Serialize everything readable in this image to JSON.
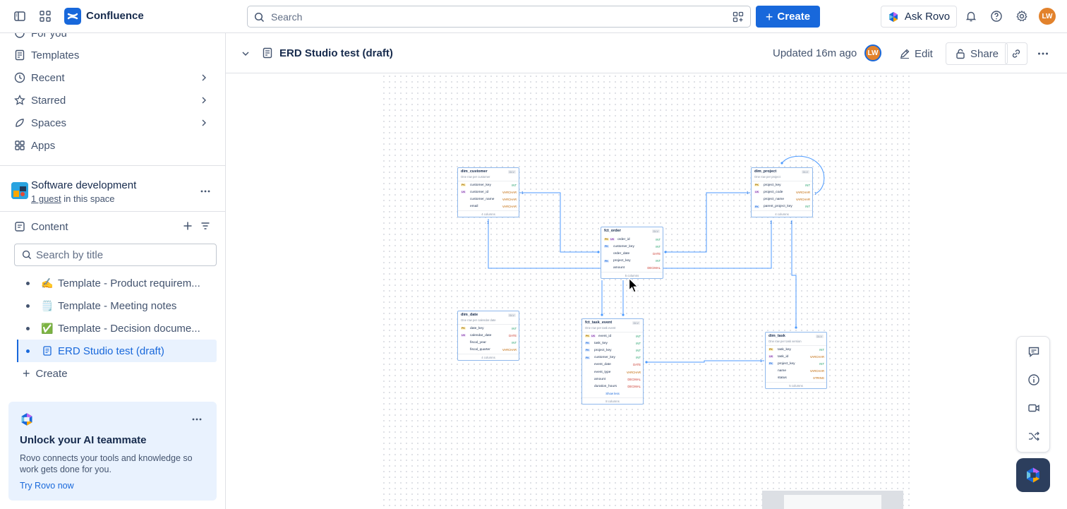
{
  "app": {
    "name": "Confluence"
  },
  "topbar": {
    "search_placeholder": "Search",
    "create_label": "Create",
    "ask_rovo_label": "Ask Rovo",
    "avatar_initials": "LW",
    "colors": {
      "brand": "#1868db",
      "avatar": "#e2822c"
    }
  },
  "sidebar": {
    "nav": [
      {
        "label": "For you",
        "icon": "home-icon"
      },
      {
        "label": "Templates",
        "icon": "templates-icon"
      },
      {
        "label": "Recent",
        "icon": "clock-icon"
      },
      {
        "label": "Starred",
        "icon": "star-icon"
      },
      {
        "label": "Spaces",
        "icon": "spaces-icon"
      },
      {
        "label": "Apps",
        "icon": "apps-icon"
      }
    ],
    "space": {
      "title": "Software development",
      "guest_link": "1 guest",
      "guest_suffix": " in this space"
    },
    "content_label": "Content",
    "search_placeholder": "Search by title",
    "tree": [
      {
        "emoji": "✍️",
        "label": "Template - Product requirem..."
      },
      {
        "emoji": "🗒️",
        "label": "Template - Meeting notes"
      },
      {
        "emoji": "✅",
        "label": "Template - Decision docume..."
      },
      {
        "emoji": "",
        "label": "ERD Studio test (draft)",
        "active": true
      }
    ],
    "create_label": "Create",
    "rovo_card": {
      "title": "Unlock your AI teammate",
      "body": "Rovo connects your tools and knowledge so work gets done for you.",
      "link": "Try Rovo now"
    }
  },
  "page": {
    "title": "ERD Studio test (draft)",
    "updated": "Updated 16m ago",
    "avatar_initials": "LW",
    "edit_label": "Edit",
    "share_label": "Share"
  },
  "erd": {
    "tables": [
      {
        "name": "dim_customer",
        "badge": "DLV",
        "desc": "One row per customer",
        "footer": "4 columns",
        "cols": [
          {
            "keys": [
              "PK"
            ],
            "name": "customer_key",
            "type": "INT"
          },
          {
            "keys": [
              "UK"
            ],
            "name": "customer_id",
            "type": "VARCHAR"
          },
          {
            "keys": [],
            "name": "customer_name",
            "type": "VARCHAR"
          },
          {
            "keys": [],
            "name": "email",
            "type": "VARCHAR"
          }
        ]
      },
      {
        "name": "fct_order",
        "badge": "DLV",
        "desc": "",
        "footer": "5 columns",
        "cols": [
          {
            "keys": [
              "PK",
              "UK"
            ],
            "name": "order_id",
            "type": "INT"
          },
          {
            "keys": [
              "FK"
            ],
            "name": "customer_key",
            "type": "INT"
          },
          {
            "keys": [],
            "name": "order_date",
            "type": "DATE"
          },
          {
            "keys": [
              "FK"
            ],
            "name": "project_key",
            "type": "INT"
          },
          {
            "keys": [],
            "name": "amount",
            "type": "DECIMAL"
          }
        ]
      },
      {
        "name": "dim_project",
        "badge": "DLV",
        "desc": "One row per project",
        "footer": "4 columns",
        "cols": [
          {
            "keys": [
              "PK"
            ],
            "name": "project_key",
            "type": "INT"
          },
          {
            "keys": [
              "UK"
            ],
            "name": "project_code",
            "type": "VARCHAR"
          },
          {
            "keys": [],
            "name": "project_name",
            "type": "VARCHAR"
          },
          {
            "keys": [
              "FK"
            ],
            "name": "parent_project_key",
            "type": "INT"
          }
        ]
      },
      {
        "name": "dim_date",
        "badge": "DLV",
        "desc": "One row per calendar date",
        "footer": "4 columns",
        "cols": [
          {
            "keys": [
              "PK"
            ],
            "name": "date_key",
            "type": "INT"
          },
          {
            "keys": [
              "UK"
            ],
            "name": "calendar_date",
            "type": "DATE"
          },
          {
            "keys": [],
            "name": "fiscal_year",
            "type": "INT"
          },
          {
            "keys": [],
            "name": "fiscal_quarter",
            "type": "VARCHAR"
          }
        ]
      },
      {
        "name": "fct_task_event",
        "badge": "DLV",
        "desc": "One row per task event",
        "footer": "8 columns",
        "showless": "Show less",
        "cols": [
          {
            "keys": [
              "PK",
              "UK"
            ],
            "name": "event_id",
            "type": "INT"
          },
          {
            "keys": [
              "FK"
            ],
            "name": "task_key",
            "type": "INT"
          },
          {
            "keys": [
              "FK"
            ],
            "name": "project_key",
            "type": "INT"
          },
          {
            "keys": [
              "FK"
            ],
            "name": "customer_key",
            "type": "INT"
          },
          {
            "keys": [],
            "name": "event_date",
            "type": "DATE"
          },
          {
            "keys": [],
            "name": "event_type",
            "type": "VARCHAR"
          },
          {
            "keys": [],
            "name": "amount",
            "type": "DECIMAL"
          },
          {
            "keys": [],
            "name": "duration_hours",
            "type": "DECIMAL"
          }
        ]
      },
      {
        "name": "dim_task",
        "badge": "DLV",
        "desc": "One row per task version",
        "footer": "5 columns",
        "cols": [
          {
            "keys": [
              "PK"
            ],
            "name": "task_key",
            "type": "INT"
          },
          {
            "keys": [
              "UK"
            ],
            "name": "task_id",
            "type": "VARCHAR"
          },
          {
            "keys": [
              "FK"
            ],
            "name": "project_key",
            "type": "INT"
          },
          {
            "keys": [],
            "name": "name",
            "type": "VARCHAR"
          },
          {
            "keys": [],
            "name": "status",
            "type": "STRING"
          }
        ]
      }
    ]
  }
}
